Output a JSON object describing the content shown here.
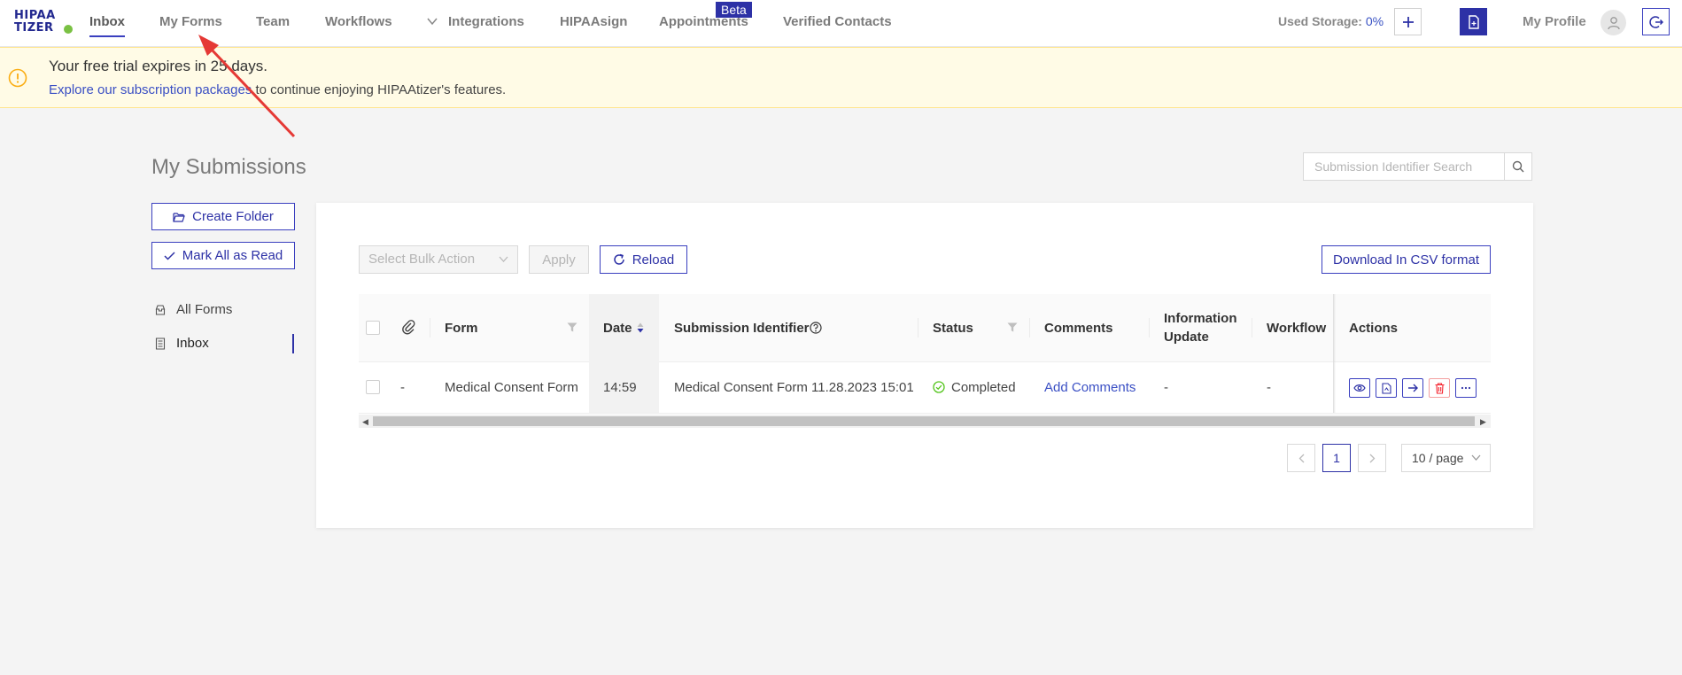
{
  "app": {
    "logo_line1": "HIPAA",
    "logo_line2": "TIZER"
  },
  "nav": {
    "items": [
      "Inbox",
      "My Forms",
      "Team",
      "Workflows",
      "Integrations",
      "HIPAAsign",
      "Appointments",
      "Verified Contacts"
    ],
    "active": "Inbox",
    "beta_badge": "Beta"
  },
  "header_right": {
    "storage_label": "Used Storage:",
    "storage_value": "0%",
    "profile_label": "My Profile",
    "icons": [
      "plus-icon",
      "document-icon",
      "user-icon",
      "logout-icon"
    ]
  },
  "banner": {
    "title": "Your free trial expires in 25 days.",
    "link_text": "Explore our subscription packages",
    "rest_text": " to continue enjoying HIPAAtizer's features."
  },
  "page": {
    "title": "My Submissions",
    "search_placeholder": "Submission Identifier Search"
  },
  "sidebar": {
    "create_folder": "Create Folder",
    "mark_all_read": "Mark All as Read",
    "items": [
      "All Forms",
      "Inbox"
    ],
    "active": "Inbox"
  },
  "toolbar": {
    "bulk_placeholder": "Select Bulk Action",
    "apply": "Apply",
    "reload": "Reload",
    "download_csv": "Download In CSV format"
  },
  "table": {
    "columns": [
      "Form",
      "Date",
      "Submission Identifier",
      "Status",
      "Comments",
      "Information Update",
      "Workflow",
      "Actions"
    ],
    "information_update_line1": "Information",
    "information_update_line2": "Update",
    "rows": [
      {
        "attachment": "-",
        "form": "Medical Consent Form",
        "date": "14:59",
        "submission_identifier": "Medical Consent Form 11.28.2023 15:01",
        "status": "Completed",
        "comments": "Add Comments",
        "information_update": "-",
        "workflow": "-"
      }
    ]
  },
  "pagination": {
    "current_page": "1",
    "page_size": "10 / page"
  },
  "colors": {
    "accent": "#2d31a6",
    "link": "#3a4fc4",
    "success": "#52c41a",
    "danger": "#f5222d",
    "warning": "#faad14",
    "annotation_arrow": "#e53935"
  }
}
